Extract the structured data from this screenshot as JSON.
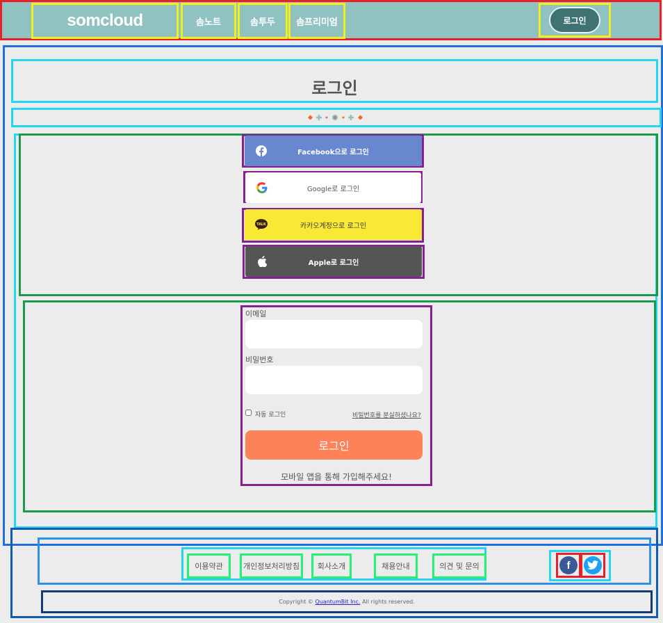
{
  "header": {
    "logo": "somcloud",
    "nav": [
      "솜노트",
      "솜투두",
      "솜프리미엄"
    ],
    "login_label": "로그인"
  },
  "main": {
    "title": "로그인",
    "social": {
      "facebook": "Facebook으로 로그인",
      "google": "Google로 로그인",
      "kakao": "카카오계정으로 로그인",
      "kakao_icon_text": "TALK",
      "apple": "Apple로 로그인"
    },
    "form": {
      "email_label": "이메일",
      "email_value": "",
      "password_label": "비밀번호",
      "password_value": "",
      "auto_login_label": "자동 로그인",
      "auto_login_checked": false,
      "forgot_label": "비밀번호를 분실하셨나요?",
      "submit_label": "로그인",
      "signup_note": "모바일 앱을 통해 가입해주세요!"
    }
  },
  "footer": {
    "links": [
      "이용약관",
      "개인정보처리방침",
      "회사소개",
      "채용안내",
      "의견 및 문의"
    ],
    "copyright_prefix": "Copyright ©",
    "company_name": "QuantumBit Inc.",
    "copyright_suffix": "All rights reserved."
  },
  "colors": {
    "header_bg": "#8fc2c0",
    "login_btn": "#3f7371",
    "facebook": "#6787cf",
    "kakao": "#f9e935",
    "apple": "#555555",
    "submit": "#fd8257",
    "page_bg": "#ececec"
  },
  "icons": {
    "facebook": "facebook-icon",
    "google": "google-icon",
    "kakao": "kakao-talk-icon",
    "apple": "apple-icon",
    "footer_facebook": "facebook-icon",
    "footer_twitter": "twitter-icon"
  }
}
